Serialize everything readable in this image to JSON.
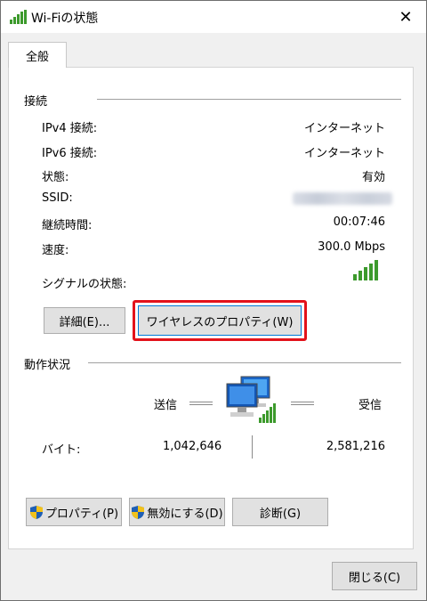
{
  "window": {
    "title": "Wi-Fiの状態",
    "close_glyph": "✕"
  },
  "tab": {
    "label": "全般"
  },
  "connection": {
    "header": "接続",
    "rows": [
      {
        "label": "IPv4 接続:",
        "value": "インターネット"
      },
      {
        "label": "IPv6 接続:",
        "value": "インターネット"
      },
      {
        "label": "状態:",
        "value": "有効"
      },
      {
        "label": "SSID:",
        "value": ""
      },
      {
        "label": "継続時間:",
        "value": "00:07:46"
      },
      {
        "label": "速度:",
        "value": "300.0 Mbps"
      }
    ],
    "signal_label": "シグナルの状態:",
    "signal_bars": 5
  },
  "buttons": {
    "details": "詳細(E)...",
    "wireless_properties": "ワイヤレスのプロパティ(W)",
    "properties": "プロパティ(P)",
    "disable": "無効にする(D)",
    "diagnose": "診断(G)",
    "close": "閉じる(C)"
  },
  "activity": {
    "header": "動作状況",
    "sent_label": "送信",
    "received_label": "受信",
    "bytes_label": "バイト:",
    "bytes_sent": "1,042,646",
    "bytes_received": "2,581,216"
  },
  "colors": {
    "highlight": "#e3121b",
    "signal_green": "#3c9a2c",
    "focus_blue": "#0078d7"
  }
}
